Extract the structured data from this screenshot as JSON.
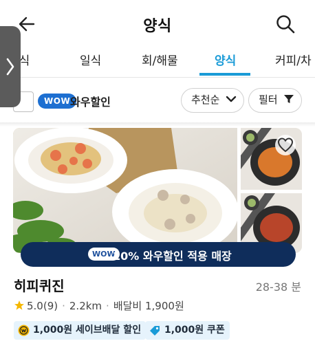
{
  "header": {
    "title": "양식"
  },
  "tabs": [
    {
      "label": "중식"
    },
    {
      "label": "일식"
    },
    {
      "label": "회/해물"
    },
    {
      "label": "양식"
    },
    {
      "label": "커피/차"
    }
  ],
  "active_tab": "양식",
  "filter": {
    "wow_badge": "WOW",
    "wow_label": "와우할인",
    "sort_label": "추천순",
    "filter_label": "필터"
  },
  "banner": {
    "wow_badge": "WOW",
    "text": "10% 와우할인 적용 매장"
  },
  "store": {
    "name": "히피퀴진",
    "delivery_time": "28-38 분",
    "rating": "5.0",
    "review_count": "(9)",
    "distance": "2.2km",
    "delivery_fee": "배달비 1,900원"
  },
  "coupons": [
    {
      "label": "1,000원 세이브배달 할인"
    },
    {
      "label": "1,000원 쿠폰"
    }
  ],
  "colors": {
    "accent": "#1a9bd7",
    "banner_bg": "#0f2d5b",
    "wow_blue": "#1d6fd1",
    "chip_bg": "#e6f3fc",
    "star": "#f5b700"
  },
  "icons": {
    "back": "arrow-left-icon",
    "search": "search-icon",
    "drawer": "chevron-right-icon",
    "sort": "chevron-down-icon",
    "filter": "funnel-icon",
    "favorite": "heart-icon",
    "rating": "star-icon",
    "save_delivery": "coin-icon",
    "coupon": "tag-icon"
  }
}
